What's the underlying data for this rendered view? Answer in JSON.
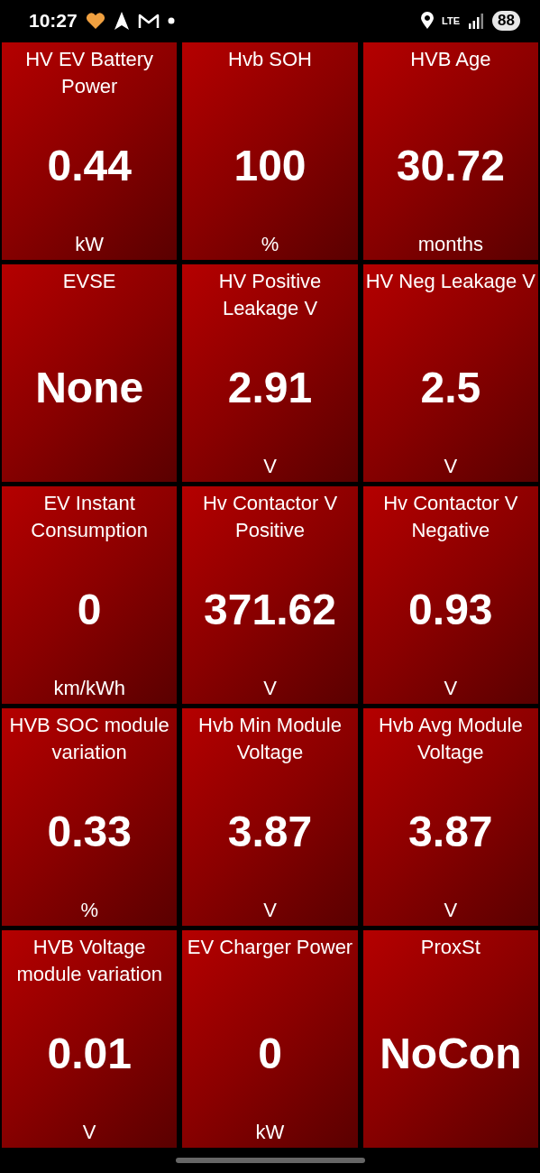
{
  "status_bar": {
    "time": "10:27",
    "network": "LTE",
    "battery": "88"
  },
  "tiles": [
    {
      "title": "HV EV Battery Power",
      "value": "0.44",
      "unit": "kW"
    },
    {
      "title": "Hvb SOH",
      "value": "100",
      "unit": "%"
    },
    {
      "title": "HVB Age",
      "value": "30.72",
      "unit": "months"
    },
    {
      "title": "EVSE",
      "value": "None"
    },
    {
      "title": "HV Positive Leakage V",
      "value": "2.91",
      "unit": "V"
    },
    {
      "title": "HV Neg Leakage V",
      "value": "2.5",
      "unit": "V"
    },
    {
      "title": "EV Instant Consumption",
      "value": "0",
      "unit": "km/kWh"
    },
    {
      "title": "Hv Contactor V Positive",
      "value": "371.62",
      "unit": "V"
    },
    {
      "title": "Hv Contactor V Negative",
      "value": "0.93",
      "unit": "V"
    },
    {
      "title": "HVB SOC module variation",
      "value": "0.33",
      "unit": "%"
    },
    {
      "title": "Hvb Min Module Voltage",
      "value": "3.87",
      "unit": "V"
    },
    {
      "title": "Hvb Avg Module Voltage",
      "value": "3.87",
      "unit": "V"
    },
    {
      "title": "HVB Voltage module variation",
      "value": "0.01",
      "unit": "V"
    },
    {
      "title": "EV Charger Power",
      "value": "0",
      "unit": "kW"
    },
    {
      "title": "ProxSt",
      "value": "NoCon"
    }
  ]
}
